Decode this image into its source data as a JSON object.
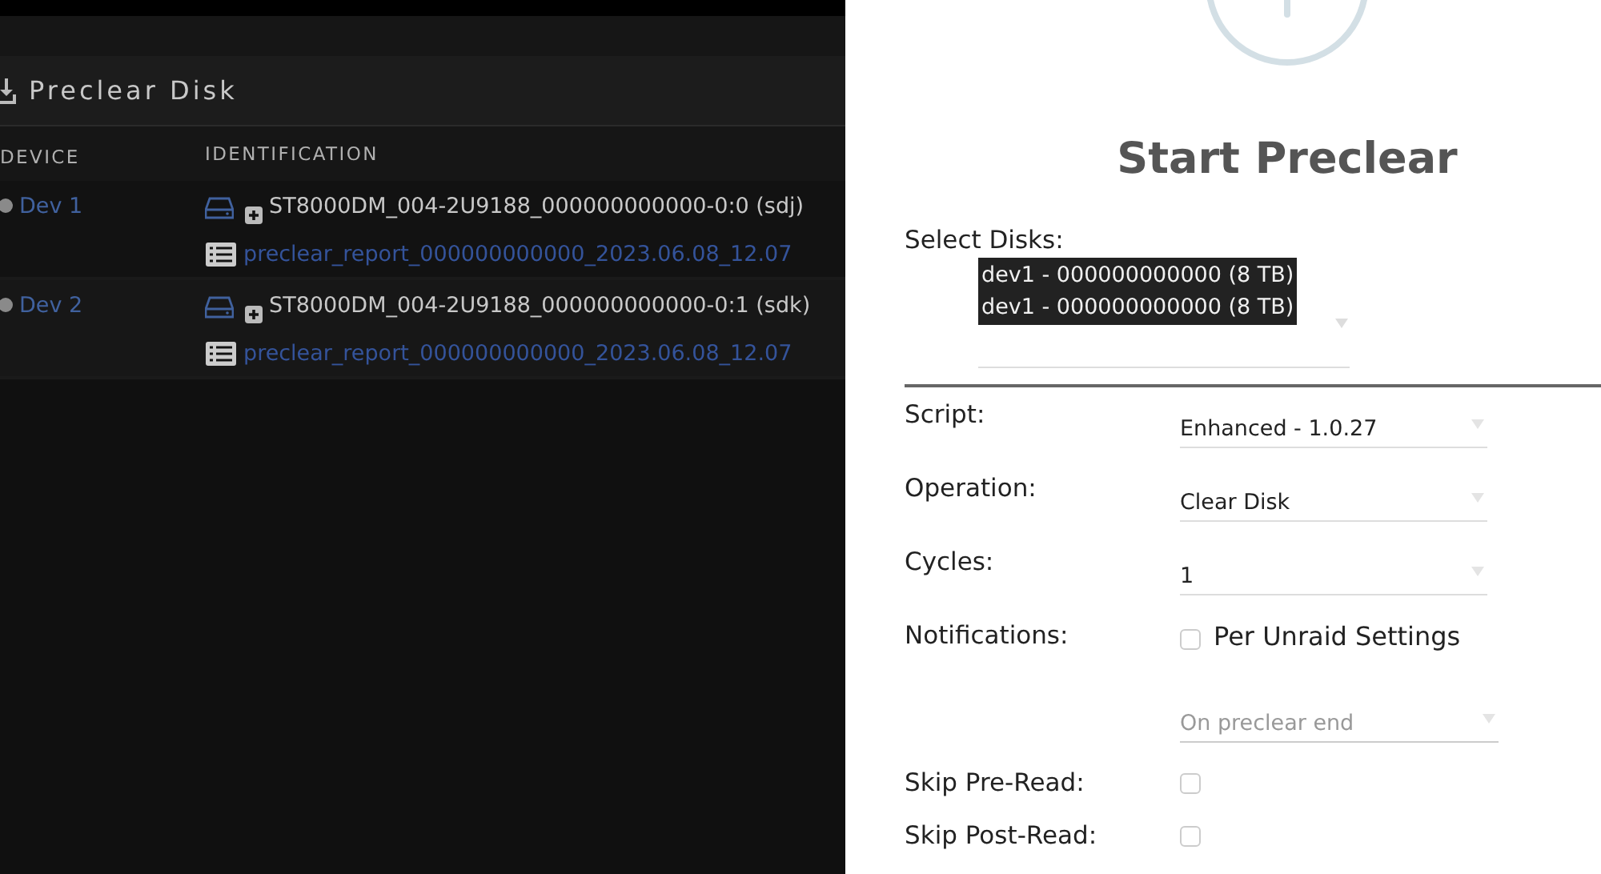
{
  "panel": {
    "title": "Preclear Disk"
  },
  "table": {
    "columns": [
      "DEVICE",
      "IDENTIFICATION"
    ],
    "rows": [
      {
        "device": "Dev 1",
        "identification": "ST8000DM_004-2U9188_000000000000-0:0 (sdj)",
        "report": "preclear_report_000000000000_2023.06.08_12.07"
      },
      {
        "device": "Dev 2",
        "identification": "ST8000DM_004-2U9188_000000000000-0:1 (sdk)",
        "report": "preclear_report_000000000000_2023.06.08_12.07"
      }
    ]
  },
  "dialog": {
    "title": "Start Preclear",
    "select_disks": {
      "label": "Select Disks:",
      "options": [
        {
          "label": "dev1 - 000000000000 (8 TB)",
          "selected": true
        },
        {
          "label": "dev1 - 000000000000 (8 TB)",
          "selected": true
        }
      ]
    },
    "fields": [
      {
        "kind": "select",
        "label": "Script:",
        "value": "Enhanced - 1.0.27"
      },
      {
        "kind": "select",
        "label": "Operation:",
        "value": "Clear Disk"
      },
      {
        "kind": "select",
        "label": "Cycles:",
        "value": "1"
      },
      {
        "kind": "checkbox",
        "label": "Notifications:",
        "text": "Per Unraid Settings",
        "checked": false
      },
      {
        "kind": "select",
        "value": "On preclear end",
        "disabled": true
      },
      {
        "kind": "checkbox",
        "label": "Skip Pre-Read:",
        "checked": false
      },
      {
        "kind": "checkbox",
        "label": "Skip Post-Read:",
        "checked": false
      }
    ]
  }
}
